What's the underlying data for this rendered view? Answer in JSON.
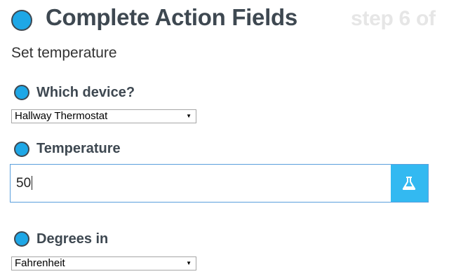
{
  "header": {
    "title": "Complete Action Fields",
    "step": "step 6 of",
    "subtitle": "Set temperature"
  },
  "fields": {
    "device": {
      "label": "Which device?",
      "value": "Hallway Thermostat"
    },
    "temperature": {
      "label": "Temperature",
      "value": "50"
    },
    "degrees": {
      "label": "Degrees in",
      "value": "Fahrenheit"
    }
  },
  "colors": {
    "accent": "#1ea7e6",
    "heading": "#3e4851",
    "button": "#33b9f1"
  },
  "icons": {
    "test_button": "flask-icon",
    "caret": "caret-down-icon"
  }
}
